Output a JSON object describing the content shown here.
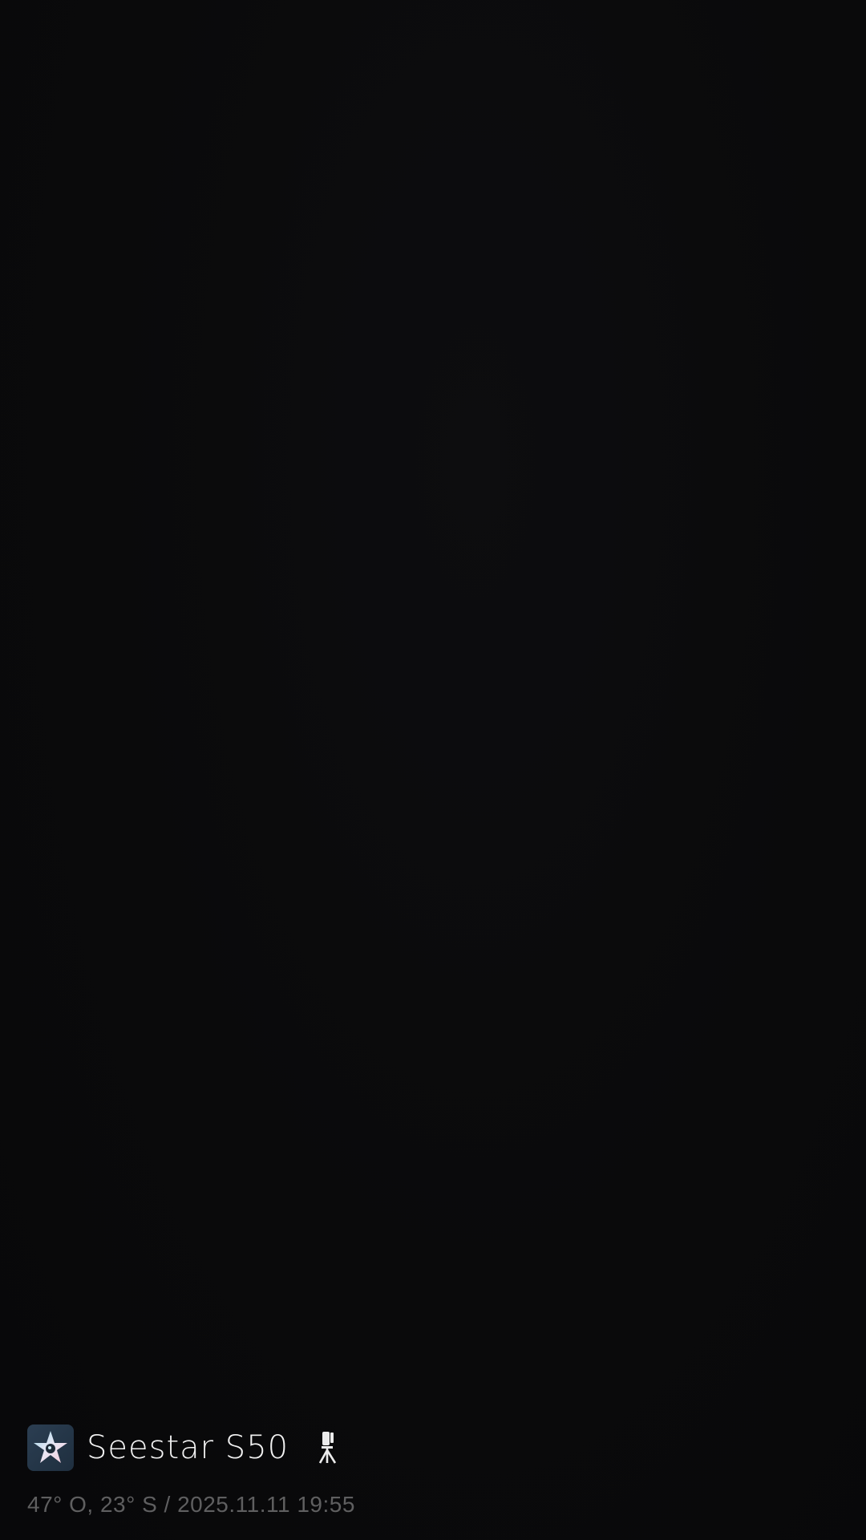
{
  "watermark": {
    "app_logo_icon": "seestar-star-logo-icon",
    "device_name": "Seestar S50",
    "device_icon": "telescope-tripod-icon"
  },
  "capture_info": {
    "text": "47° O, 23° S / 2025.11.11 19:55"
  },
  "colors": {
    "background": "#0a0a0b",
    "logo_bg": "#2b3e52",
    "device_name": "#f2f2f2",
    "meta_text": "#5f5f60"
  }
}
